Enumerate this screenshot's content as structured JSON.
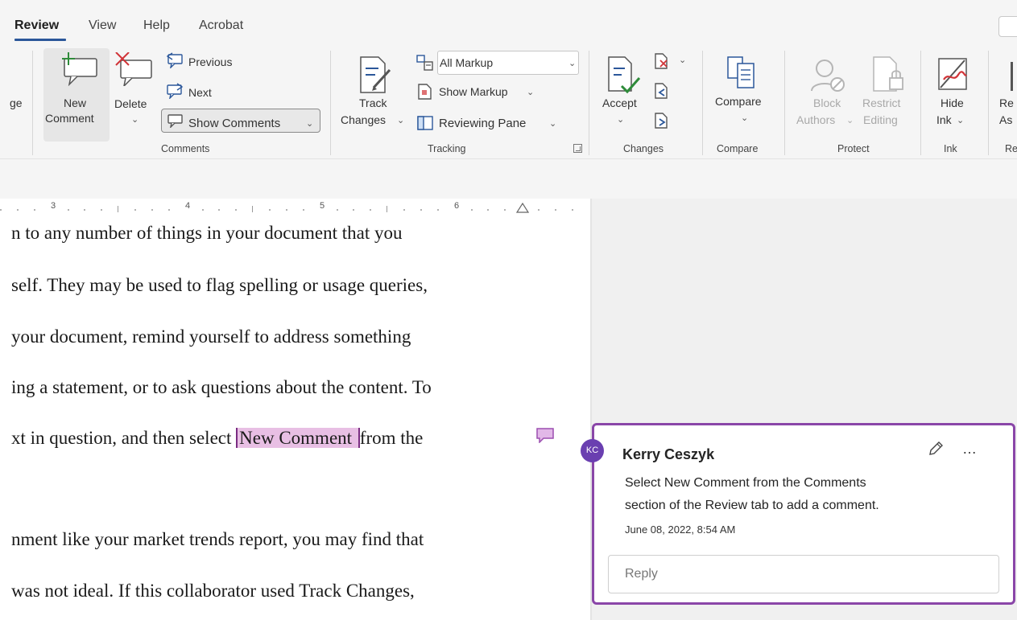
{
  "tabs": [
    "Review",
    "View",
    "Help",
    "Acrobat"
  ],
  "active_tab": "Review",
  "ribbon": {
    "cut_label": "ge",
    "comments": {
      "new_comment_line1": "New",
      "new_comment_line2": "Comment",
      "delete_label": "Delete",
      "previous_label": "Previous",
      "next_label": "Next",
      "show_comments_label": "Show Comments",
      "group_label": "Comments"
    },
    "tracking": {
      "track_changes_line1": "Track",
      "track_changes_line2": "Changes",
      "markup_select": "All Markup",
      "show_markup_label": "Show Markup",
      "reviewing_pane_label": "Reviewing Pane",
      "group_label": "Tracking"
    },
    "changes": {
      "accept_label": "Accept",
      "group_label": "Changes"
    },
    "compare": {
      "compare_label": "Compare",
      "group_label": "Compare"
    },
    "protect": {
      "block_authors_line1": "Block",
      "block_authors_line2": "Authors",
      "restrict_editing_line1": "Restrict",
      "restrict_editing_line2": "Editing",
      "group_label": "Protect"
    },
    "ink": {
      "hide_ink_line1": "Hide",
      "hide_ink_line2": "Ink",
      "group_label": "Ink"
    },
    "cut_right": {
      "line1": "Re",
      "line2": "As",
      "group_label": "Re"
    }
  },
  "ruler": {
    "numbers": [
      "3",
      "4",
      "5",
      "6"
    ]
  },
  "document": {
    "lines": [
      "n to any number of things in your document that you",
      "self. They may be used to flag spelling or usage queries,",
      " your document, remind yourself to address something",
      "ing a statement, or to ask questions about the content. To",
      "nment like your market trends report, you may find that",
      "was not ideal. If this collaborator used Track Changes,"
    ],
    "line5_before": "xt in question, and then select ",
    "line5_highlight": "New Comment ",
    "line5_after": "from the"
  },
  "comment": {
    "avatar_initials": "KC",
    "author": "Kerry Ceszyk",
    "text_line1": "Select New Comment from the Comments",
    "text_line2": "section of the Review tab to add a comment.",
    "date": "June 08, 2022, 8:54 AM",
    "reply_placeholder": "Reply",
    "more_label": "…"
  },
  "colors": {
    "accent_purple": "#8a46a8",
    "highlight": "#e8bfe4",
    "avatar": "#6a3fb0",
    "ribbon_bg": "#f5f5f5"
  }
}
